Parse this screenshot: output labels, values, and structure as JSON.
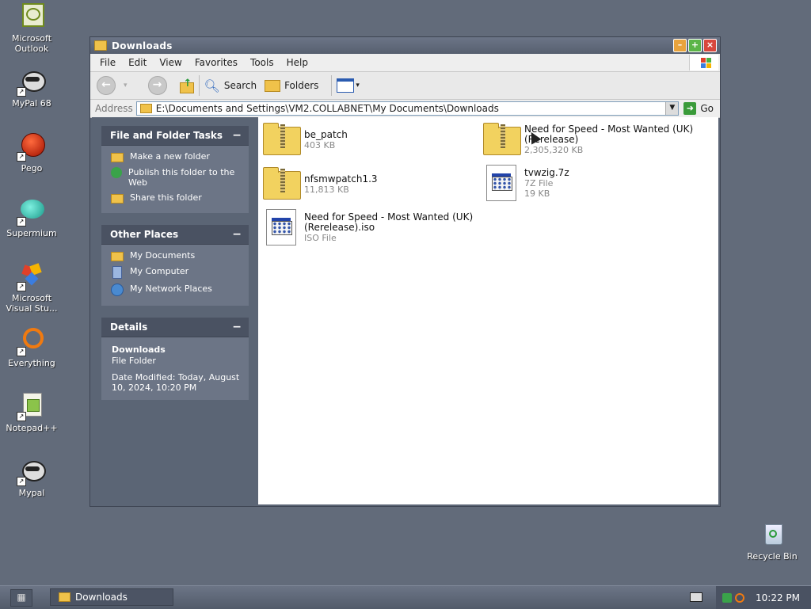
{
  "desktop": {
    "icons": [
      {
        "label": "Microsoft Outlook",
        "icon": "outlook-icon"
      },
      {
        "label": "MyPal 68",
        "icon": "raccoon-icon"
      },
      {
        "label": "Pego",
        "icon": "pego-icon"
      },
      {
        "label": "Supermium",
        "icon": "supermium-icon"
      },
      {
        "label": "Microsoft Visual Stu...",
        "icon": "visual-studio-icon"
      },
      {
        "label": "Everything",
        "icon": "everything-icon"
      },
      {
        "label": "Notepad++",
        "icon": "notepad-plus-plus-icon"
      },
      {
        "label": "Mypal",
        "icon": "raccoon-icon"
      },
      {
        "label": "Recycle Bin",
        "icon": "recycle-bin-icon"
      }
    ]
  },
  "window": {
    "title": "Downloads",
    "menu": [
      "File",
      "Edit",
      "View",
      "Favorites",
      "Tools",
      "Help"
    ],
    "toolbar": {
      "search": "Search",
      "folders": "Folders"
    },
    "address": {
      "label": "Address",
      "path": "E:\\Documents and Settings\\VM2.COLLABNET\\My Documents\\Downloads",
      "go": "Go"
    }
  },
  "sidebar": {
    "tasks": {
      "title": "File and Folder Tasks",
      "items": [
        "Make a new folder",
        "Publish this folder to the Web",
        "Share this folder"
      ]
    },
    "places": {
      "title": "Other Places",
      "items": [
        "My Documents",
        "My Computer",
        "My Network Places"
      ]
    },
    "details": {
      "title": "Details",
      "name": "Downloads",
      "type": "File Folder",
      "modified": "Date Modified: Today, August 10, 2024, 10:20 PM"
    },
    "collapse": "−"
  },
  "files": [
    {
      "name": "be_patch",
      "line2": "",
      "detail": "403 KB",
      "kind": "zip"
    },
    {
      "name": "Need for Speed - Most Wanted (UK)",
      "line2": "(Rerelease)",
      "detail": "2,305,320 KB",
      "kind": "zip"
    },
    {
      "name": "nfsmwpatch1.3",
      "line2": "",
      "detail": "11,813 KB",
      "kind": "zip"
    },
    {
      "name": "tvwzig.7z",
      "line2": "7Z File",
      "detail": "19 KB",
      "kind": "doc"
    },
    {
      "name": "Need for Speed - Most Wanted (UK)",
      "line2": "(Rerelease).iso",
      "detail": "ISO File",
      "kind": "doc"
    }
  ],
  "taskbar": {
    "task": "Downloads",
    "clock": "10:22 PM"
  }
}
